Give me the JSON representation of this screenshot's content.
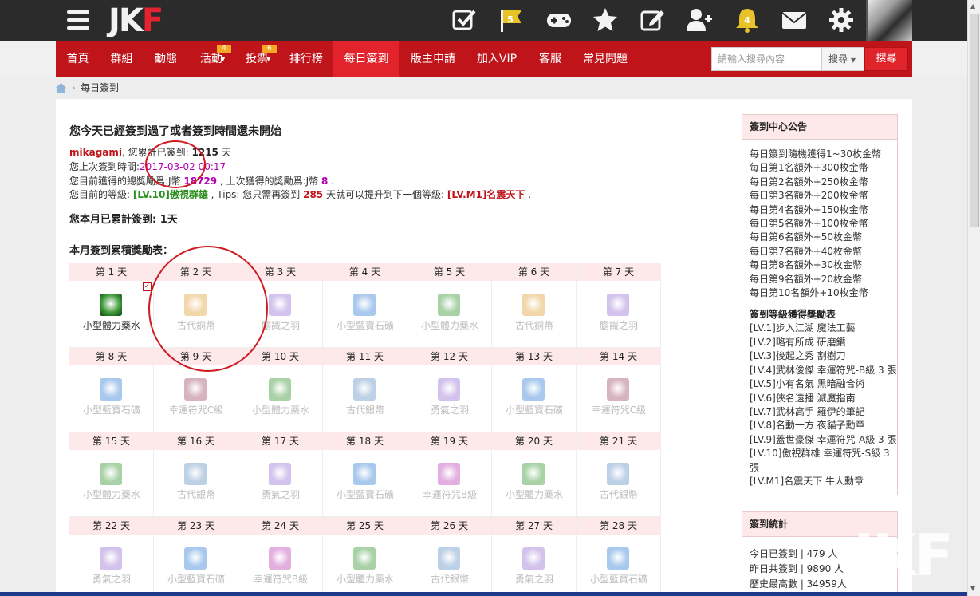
{
  "header": {
    "logo_main": "JK",
    "logo_accent": "F",
    "icons": [
      "checklist-icon",
      "flag-icon",
      "gamepad-icon",
      "star-icon",
      "edit-icon",
      "add-user-icon",
      "bell-icon",
      "mail-icon",
      "gear-icon"
    ],
    "flag_badge": "5",
    "bell_badge": "4"
  },
  "nav": {
    "items": [
      {
        "label": "首頁"
      },
      {
        "label": "群組"
      },
      {
        "label": "動態"
      },
      {
        "label": "活動",
        "badge": "4"
      },
      {
        "label": "投票",
        "badge": "6"
      },
      {
        "label": "排行榜"
      },
      {
        "label": "每日簽到"
      },
      {
        "label": "版主申請"
      },
      {
        "label": "加入VIP"
      },
      {
        "label": "客服"
      },
      {
        "label": "常見問題"
      }
    ],
    "search_placeholder": "請輸入搜尋內容",
    "search_select": "搜尋",
    "search_button": "搜尋"
  },
  "breadcrumb": {
    "current": "每日簽到"
  },
  "status": {
    "title": "您今天已經簽到過了或者簽到時間還未開始",
    "username": "mikagami",
    "total_prefix": ", 您累計已簽到: ",
    "total_days": "1215",
    "total_suffix": " 天",
    "last_prefix": "您上次簽到時間:",
    "last_time": "2017-03-02 00:17",
    "reward_prefix": "您目前獲得的總獎勵爲:J幣 ",
    "reward_total": "18729",
    "reward_mid": " , 上次獲得的獎勵爲:J幣 ",
    "reward_last": "8",
    "reward_end": " .",
    "level_prefix": "您目前的等級: ",
    "level_current": "[LV.10]傲視群雄",
    "level_mid": " , Tips: 您只需再簽到 ",
    "level_days": "285",
    "level_mid2": " 天就可以提升到下一個等級: ",
    "level_next": "[LV.M1]名震天下",
    "level_end": " .",
    "month_total": "您本月已累計簽到: 1天",
    "table_title": "本月簽到累積獎勵表："
  },
  "calendar": [
    {
      "day": "第 1 天",
      "item": "小型體力藥水",
      "kind": "potion",
      "done": true
    },
    {
      "day": "第 2 天",
      "item": "古代銅幣",
      "kind": "copper"
    },
    {
      "day": "第 3 天",
      "item": "膽識之羽",
      "kind": "feather"
    },
    {
      "day": "第 4 天",
      "item": "小型藍寶石礦",
      "kind": "sapphire"
    },
    {
      "day": "第 5 天",
      "item": "小型體力藥水",
      "kind": "potion"
    },
    {
      "day": "第 6 天",
      "item": "古代銅幣",
      "kind": "copper"
    },
    {
      "day": "第 7 天",
      "item": "膽識之羽",
      "kind": "feather"
    },
    {
      "day": "第 8 天",
      "item": "小型藍寶石礦",
      "kind": "sapphire"
    },
    {
      "day": "第 9 天",
      "item": "幸運符咒C級",
      "kind": "charm"
    },
    {
      "day": "第 10 天",
      "item": "小型體力藥水",
      "kind": "potion"
    },
    {
      "day": "第 11 天",
      "item": "古代銀幣",
      "kind": "silver"
    },
    {
      "day": "第 12 天",
      "item": "勇氣之羽",
      "kind": "feather"
    },
    {
      "day": "第 13 天",
      "item": "小型藍寶石礦",
      "kind": "sapphire"
    },
    {
      "day": "第 14 天",
      "item": "幸運符咒C級",
      "kind": "charm"
    },
    {
      "day": "第 15 天",
      "item": "小型體力藥水",
      "kind": "potion"
    },
    {
      "day": "第 16 天",
      "item": "古代銀幣",
      "kind": "silver"
    },
    {
      "day": "第 17 天",
      "item": "勇氣之羽",
      "kind": "feather"
    },
    {
      "day": "第 18 天",
      "item": "小型藍寶石礦",
      "kind": "sapphire"
    },
    {
      "day": "第 19 天",
      "item": "幸運符咒B級",
      "kind": "charmb"
    },
    {
      "day": "第 20 天",
      "item": "小型體力藥水",
      "kind": "potion"
    },
    {
      "day": "第 21 天",
      "item": "古代銀幣",
      "kind": "silver"
    },
    {
      "day": "第 22 天",
      "item": "勇氣之羽",
      "kind": "feather"
    },
    {
      "day": "第 23 天",
      "item": "小型藍寶石礦",
      "kind": "sapphire"
    },
    {
      "day": "第 24 天",
      "item": "幸運符咒B級",
      "kind": "charmb"
    },
    {
      "day": "第 25 天",
      "item": "小型體力藥水",
      "kind": "potion"
    },
    {
      "day": "第 26 天",
      "item": "古代銀幣",
      "kind": "silver"
    },
    {
      "day": "第 27 天",
      "item": "勇氣之羽",
      "kind": "feather"
    },
    {
      "day": "第 28 天",
      "item": "小型藍寶石礦",
      "kind": "sapphire"
    }
  ],
  "colors": {
    "potion": "#3f9a3a",
    "copper": "#e0a640",
    "feather": "#9b78d6",
    "sapphire": "#3f86d8",
    "charm": "#a5566e",
    "charmb": "#c14bb9",
    "silver": "#6b96c8"
  },
  "sidebar": {
    "announce_title": "簽到中心公告",
    "announce_lines": [
      "每日簽到隨機獲得1~30枚金幣",
      "每日第1名額外+300枚金幣",
      "每日第2名額外+250枚金幣",
      "每日第3名額外+200枚金幣",
      "每日第4名額外+150枚金幣",
      "每日第5名額外+100枚金幣",
      "每日第6名額外+50枚金幣",
      "每日第7名額外+40枚金幣",
      "每日第8名額外+30枚金幣",
      "每日第9名額外+20枚金幣",
      "每日第10名額外+10枚金幣"
    ],
    "level_title": "簽到等級獲得獎勵表",
    "level_lines": [
      "[LV.1]步入江湖 魔法工藝",
      "[LV.2]略有所成 研磨鑽",
      "[LV.3]後起之秀 割樹刀",
      "[LV.4]武林俊傑 幸運符咒-B級 3 張",
      "[LV.5]小有名氣 黑暗融合術",
      "[LV.6]俠名遠播 滅魔指南",
      "[LV.7]武林高手 羅伊的筆記",
      "[LV.8]名動一方 夜貓子勳章",
      "[LV.9]蓋世豪傑 幸運符咒-A級 3 張",
      "[LV.10]傲視群雄 幸運符咒-S級 3",
      "張",
      "[LV.M1]名震天下 牛人勳章"
    ],
    "stats_title": "簽到統計",
    "stats_lines": [
      "今日已簽到 | 479 人",
      "昨日共簽到 | 9890 人",
      "歷史最高數 | 34959人"
    ]
  },
  "watermark": "JKF"
}
